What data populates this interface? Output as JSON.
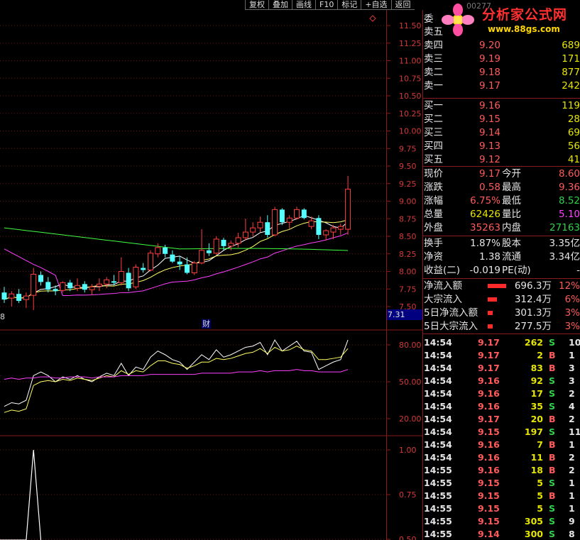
{
  "toolbar": {
    "buttons": [
      "复权",
      "叠加",
      "画线",
      "F10",
      "标记",
      "+自选",
      "返回"
    ]
  },
  "logo": {
    "title": "分析家公式网",
    "url": "www.88gs.com",
    "stock_name_partial": "00277"
  },
  "colors": {
    "up": "#ff4040",
    "down": "#54ffff",
    "ma_white": "#ffffff",
    "ma_yellow": "#ffff64",
    "ma_magenta": "#ff40ff",
    "ma_green": "#40ff40",
    "grid": "#8b1a1a"
  },
  "main_axis": {
    "ticks": [
      "11.50",
      "11.25",
      "11.00",
      "10.75",
      "10.50",
      "10.25",
      "10.00",
      "9.75",
      "9.50",
      "9.25",
      "9.00",
      "8.75",
      "8.50",
      "8.25",
      "8.00",
      "7.75",
      "7.50"
    ],
    "current_tag": "7.31",
    "finance_marker": "财"
  },
  "left_edge_label": "8",
  "ind1_axis": {
    "ticks": [
      "80.00",
      "50.00",
      "20.00"
    ]
  },
  "ind2_axis": {
    "ticks": [
      "1.00",
      "0.75",
      "0.50"
    ]
  },
  "orderbook": {
    "header": "委",
    "sells": [
      {
        "label": "卖五",
        "price": "",
        "vol": ""
      },
      {
        "label": "卖四",
        "price": "9.20",
        "vol": "689"
      },
      {
        "label": "卖三",
        "price": "9.19",
        "vol": "171"
      },
      {
        "label": "卖二",
        "price": "9.18",
        "vol": "877"
      },
      {
        "label": "卖一",
        "price": "9.17",
        "vol": "242"
      }
    ],
    "buys": [
      {
        "label": "买一",
        "price": "9.16",
        "vol": "119"
      },
      {
        "label": "买二",
        "price": "9.15",
        "vol": "28"
      },
      {
        "label": "买三",
        "price": "9.14",
        "vol": "69"
      },
      {
        "label": "买四",
        "price": "9.13",
        "vol": "56"
      },
      {
        "label": "买五",
        "price": "9.12",
        "vol": "41"
      }
    ]
  },
  "quote": [
    {
      "l1": "现价",
      "v1": "9.17",
      "l2": "今开",
      "v2": "8.60",
      "c2": "r"
    },
    {
      "l1": "涨跌",
      "v1": "0.58",
      "l2": "最高",
      "v2": "9.36",
      "c2": "r"
    },
    {
      "l1": "涨幅",
      "v1": "6.75%",
      "l2": "最低",
      "v2": "8.52",
      "c2": "g"
    },
    {
      "l1": "总量",
      "v1": "62426",
      "l2": "量比",
      "v2": "5.10",
      "c2": "m",
      "c1": "y"
    },
    {
      "l1": "外盘",
      "v1": "35263",
      "l2": "内盘",
      "v2": "27163",
      "c2": "g"
    }
  ],
  "stats": [
    {
      "l1": "换手",
      "v1": "1.87%",
      "l2": "股本",
      "v2": "3.35亿"
    },
    {
      "l1": "净资",
      "v1": "1.38",
      "l2": "流通",
      "v2": "3.34亿"
    },
    {
      "l1": "收益(二)",
      "v1": "-0.019",
      "l2": "PE(动)",
      "v2": "-"
    }
  ],
  "flows": [
    {
      "label": "净流入额",
      "value": "696.3万",
      "pct": "12%",
      "bar": 12
    },
    {
      "label": "大宗流入",
      "value": "312.4万",
      "pct": "6%",
      "bar": 6
    },
    {
      "label": "5日净流入额",
      "value": "301.3万",
      "pct": "3%",
      "bar": 3
    },
    {
      "label": "5日大宗流入",
      "value": "277.5万",
      "pct": "3%",
      "bar": 3
    }
  ],
  "trades": [
    {
      "time": "14:54",
      "price": "9.17",
      "vol": "262",
      "side": "S",
      "n": "10"
    },
    {
      "time": "14:54",
      "price": "9.17",
      "vol": "2",
      "side": "B",
      "n": "1"
    },
    {
      "time": "14:54",
      "price": "9.17",
      "vol": "83",
      "side": "B",
      "n": "3"
    },
    {
      "time": "14:54",
      "price": "9.16",
      "vol": "92",
      "side": "S",
      "n": "3"
    },
    {
      "time": "14:54",
      "price": "9.16",
      "vol": "17",
      "side": "S",
      "n": "2"
    },
    {
      "time": "14:54",
      "price": "9.16",
      "vol": "35",
      "side": "S",
      "n": "4"
    },
    {
      "time": "14:54",
      "price": "9.17",
      "vol": "20",
      "side": "B",
      "n": "2"
    },
    {
      "time": "14:54",
      "price": "9.15",
      "vol": "197",
      "side": "S",
      "n": "11"
    },
    {
      "time": "14:54",
      "price": "9.16",
      "vol": "7",
      "side": "B",
      "n": "1"
    },
    {
      "time": "14:54",
      "price": "9.16",
      "vol": "11",
      "side": "B",
      "n": "2"
    },
    {
      "time": "14:55",
      "price": "9.16",
      "vol": "18",
      "side": "B",
      "n": "2"
    },
    {
      "time": "14:55",
      "price": "9.15",
      "vol": "5",
      "side": "S",
      "n": "1"
    },
    {
      "time": "14:55",
      "price": "9.15",
      "vol": "5",
      "side": "B",
      "n": "1"
    },
    {
      "time": "14:55",
      "price": "9.15",
      "vol": "5",
      "side": "S",
      "n": "1"
    },
    {
      "time": "14:55",
      "price": "9.15",
      "vol": "305",
      "side": "S",
      "n": "9"
    },
    {
      "time": "14:55",
      "price": "9.14",
      "vol": "300",
      "side": "S",
      "n": "8"
    }
  ],
  "candles": [
    {
      "o": 7.7,
      "h": 7.78,
      "l": 7.55,
      "c": 7.6
    },
    {
      "o": 7.62,
      "h": 7.72,
      "l": 7.5,
      "c": 7.68
    },
    {
      "o": 7.68,
      "h": 7.75,
      "l": 7.55,
      "c": 7.58
    },
    {
      "o": 7.6,
      "h": 7.7,
      "l": 7.48,
      "c": 7.65
    },
    {
      "o": 7.66,
      "h": 8.05,
      "l": 7.45,
      "c": 7.96
    },
    {
      "o": 7.95,
      "h": 8.0,
      "l": 7.8,
      "c": 7.85
    },
    {
      "o": 7.85,
      "h": 7.92,
      "l": 7.7,
      "c": 7.74
    },
    {
      "o": 7.75,
      "h": 7.8,
      "l": 7.66,
      "c": 7.72
    },
    {
      "o": 7.73,
      "h": 7.86,
      "l": 7.7,
      "c": 7.84
    },
    {
      "o": 7.84,
      "h": 7.88,
      "l": 7.72,
      "c": 7.76
    },
    {
      "o": 7.76,
      "h": 7.9,
      "l": 7.72,
      "c": 7.8
    },
    {
      "o": 7.82,
      "h": 7.86,
      "l": 7.7,
      "c": 7.74
    },
    {
      "o": 7.74,
      "h": 7.82,
      "l": 7.66,
      "c": 7.78
    },
    {
      "o": 7.79,
      "h": 7.9,
      "l": 7.72,
      "c": 7.82
    },
    {
      "o": 7.82,
      "h": 7.92,
      "l": 7.76,
      "c": 7.88
    },
    {
      "o": 7.86,
      "h": 7.95,
      "l": 7.8,
      "c": 7.84
    },
    {
      "o": 7.84,
      "h": 8.2,
      "l": 7.8,
      "c": 8.0
    },
    {
      "o": 7.98,
      "h": 8.05,
      "l": 7.72,
      "c": 7.76
    },
    {
      "o": 7.78,
      "h": 8.1,
      "l": 7.75,
      "c": 8.06
    },
    {
      "o": 8.05,
      "h": 8.12,
      "l": 7.98,
      "c": 8.02
    },
    {
      "o": 8.02,
      "h": 8.3,
      "l": 8.0,
      "c": 8.26
    },
    {
      "o": 8.25,
      "h": 8.4,
      "l": 8.2,
      "c": 8.34
    },
    {
      "o": 8.34,
      "h": 8.38,
      "l": 8.2,
      "c": 8.25
    },
    {
      "o": 8.24,
      "h": 8.3,
      "l": 8.12,
      "c": 8.14
    },
    {
      "o": 8.14,
      "h": 8.22,
      "l": 8.02,
      "c": 8.1
    },
    {
      "o": 8.1,
      "h": 8.2,
      "l": 7.96,
      "c": 7.98
    },
    {
      "o": 7.98,
      "h": 8.15,
      "l": 7.95,
      "c": 8.12
    },
    {
      "o": 8.12,
      "h": 8.6,
      "l": 8.1,
      "c": 8.3
    },
    {
      "o": 8.3,
      "h": 8.4,
      "l": 8.22,
      "c": 8.26
    },
    {
      "o": 8.26,
      "h": 8.5,
      "l": 8.24,
      "c": 8.46
    },
    {
      "o": 8.45,
      "h": 8.48,
      "l": 8.3,
      "c": 8.36
    },
    {
      "o": 8.36,
      "h": 8.44,
      "l": 8.3,
      "c": 8.4
    },
    {
      "o": 8.4,
      "h": 8.55,
      "l": 8.34,
      "c": 8.48
    },
    {
      "o": 8.48,
      "h": 8.75,
      "l": 8.44,
      "c": 8.56
    },
    {
      "o": 8.56,
      "h": 8.7,
      "l": 8.5,
      "c": 8.62
    },
    {
      "o": 8.62,
      "h": 8.78,
      "l": 8.56,
      "c": 8.7
    },
    {
      "o": 8.7,
      "h": 8.8,
      "l": 8.48,
      "c": 8.52
    },
    {
      "o": 8.52,
      "h": 8.92,
      "l": 8.5,
      "c": 8.88
    },
    {
      "o": 8.88,
      "h": 8.9,
      "l": 8.66,
      "c": 8.7
    },
    {
      "o": 8.7,
      "h": 8.8,
      "l": 8.6,
      "c": 8.76
    },
    {
      "o": 8.76,
      "h": 8.92,
      "l": 8.74,
      "c": 8.88
    },
    {
      "o": 8.88,
      "h": 8.9,
      "l": 8.74,
      "c": 8.76
    },
    {
      "o": 8.64,
      "h": 8.78,
      "l": 8.6,
      "c": 8.72
    },
    {
      "o": 8.76,
      "h": 8.8,
      "l": 8.46,
      "c": 8.52
    },
    {
      "o": 8.52,
      "h": 8.6,
      "l": 8.44,
      "c": 8.58
    },
    {
      "o": 8.56,
      "h": 8.66,
      "l": 8.46,
      "c": 8.62
    },
    {
      "o": 8.6,
      "h": 8.68,
      "l": 8.52,
      "c": 8.64
    },
    {
      "o": 8.6,
      "h": 9.36,
      "l": 8.52,
      "c": 9.17
    }
  ],
  "k_line": [
    30,
    33,
    32,
    35,
    55,
    58,
    55,
    50,
    54,
    52,
    55,
    52,
    50,
    54,
    57,
    55,
    65,
    55,
    62,
    60,
    70,
    75,
    72,
    68,
    66,
    60,
    66,
    72,
    68,
    76,
    70,
    72,
    75,
    78,
    79,
    82,
    72,
    84,
    75,
    79,
    83,
    75,
    74,
    60,
    63,
    66,
    68,
    84
  ],
  "d_line": [
    25,
    27,
    26,
    28,
    47,
    50,
    51,
    50,
    52,
    51,
    53,
    52,
    51,
    53,
    55,
    54,
    59,
    56,
    59,
    58,
    63,
    67,
    67,
    65,
    64,
    61,
    63,
    66,
    66,
    69,
    68,
    69,
    71,
    73,
    74,
    77,
    73,
    78,
    75,
    76,
    79,
    76,
    75,
    68,
    68,
    69,
    70,
    77
  ],
  "j_line": [
    52,
    53,
    52,
    53,
    53,
    54,
    54,
    53,
    53,
    54,
    54,
    54,
    53,
    54,
    54,
    54,
    55,
    55,
    55,
    55,
    56,
    56,
    56,
    56,
    56,
    56,
    56,
    57,
    57,
    57,
    57,
    57,
    58,
    58,
    58,
    59,
    58,
    59,
    59,
    59,
    60,
    59,
    59,
    58,
    58,
    58,
    58,
    60
  ],
  "spike": [
    0,
    0,
    0,
    0,
    1,
    0
  ]
}
